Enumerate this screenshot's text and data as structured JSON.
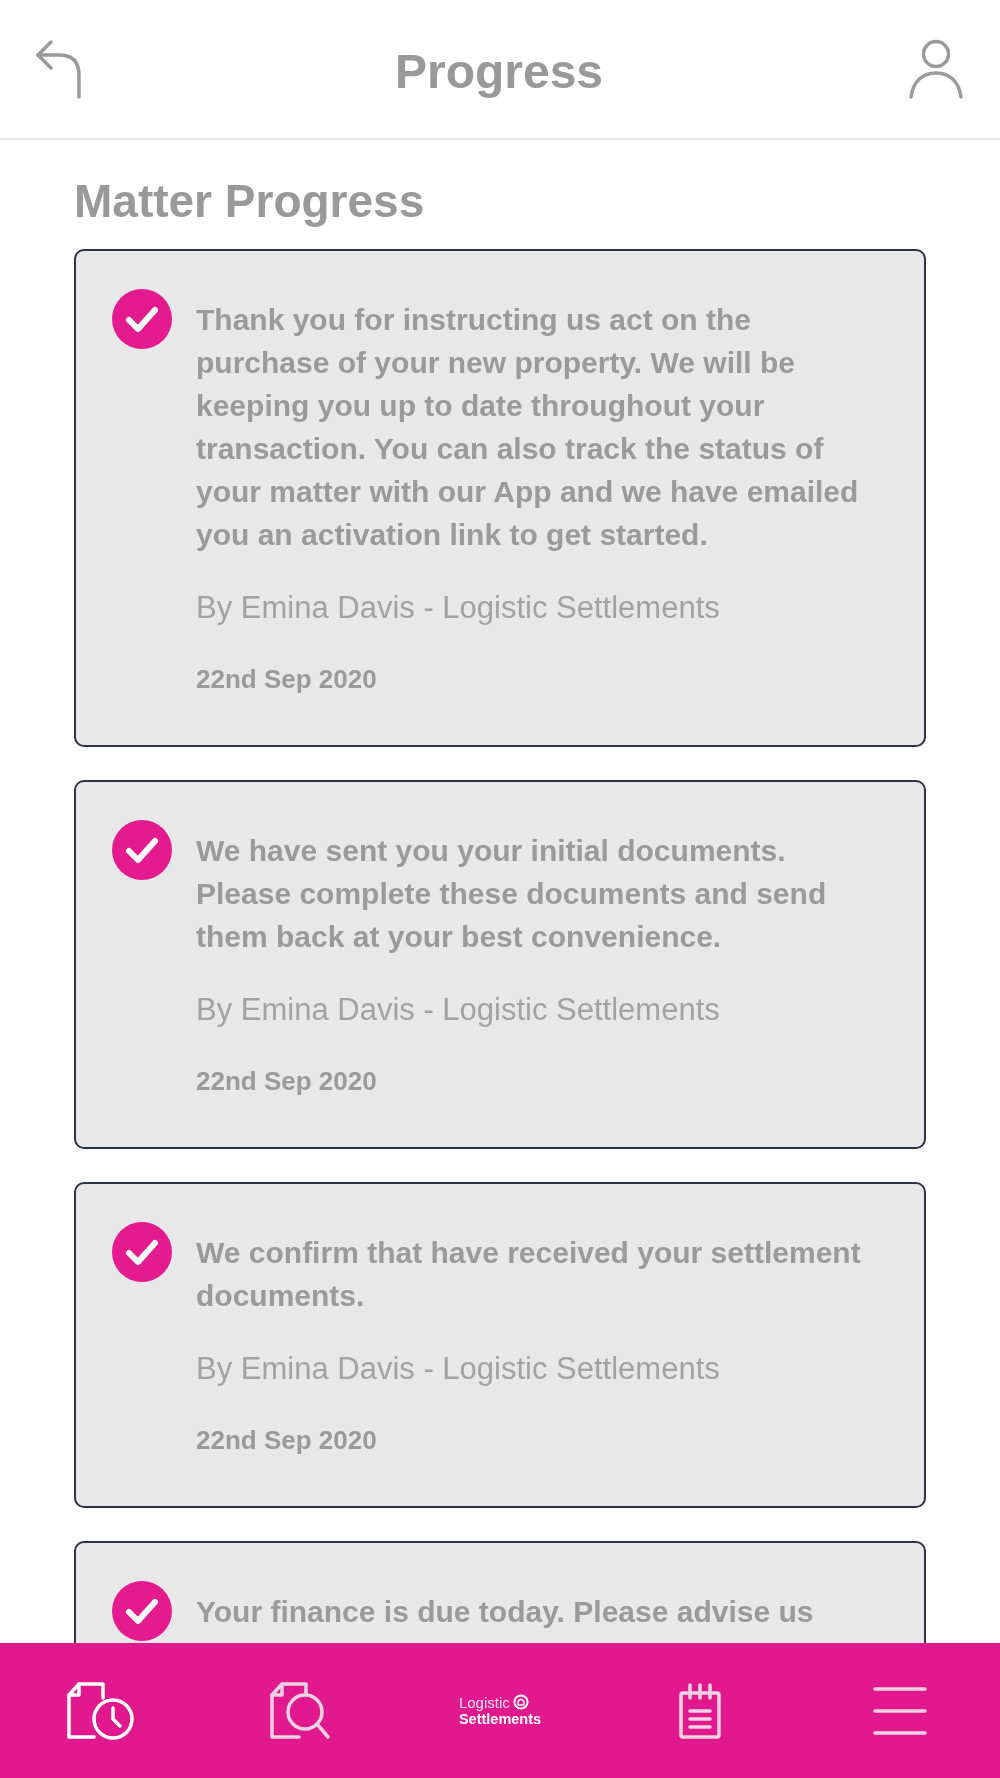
{
  "header": {
    "title": "Progress"
  },
  "section_title": "Matter Progress",
  "cards": [
    {
      "checked": true,
      "message": "Thank you for instructing us act on the purchase of your new property. We will be keeping you up to date throughout your transaction. You can also track the status of your matter with our App and we have emailed you an activation link to get started.",
      "author": "By Emina Davis - Logistic Settlements",
      "date": "22nd Sep 2020"
    },
    {
      "checked": true,
      "message": "We have sent you your initial documents. Please complete these documents and send them back at your best convenience.",
      "author": "By Emina Davis - Logistic Settlements",
      "date": "22nd Sep 2020"
    },
    {
      "checked": true,
      "message": "We confirm that have received your settlement documents.",
      "author": "By Emina Davis - Logistic Settlements",
      "date": "22nd Sep 2020"
    },
    {
      "checked": true,
      "message": "Your finance is due today. Please advise us"
    }
  ],
  "nav": {
    "items": [
      {
        "kind": "icon",
        "selected": true
      },
      {
        "kind": "icon",
        "selected": false
      },
      {
        "kind": "logo",
        "line_1": "Logistic",
        "line_2": "Settlements",
        "selected": false
      },
      {
        "kind": "icon",
        "selected": false
      },
      {
        "kind": "icon",
        "selected": false
      }
    ]
  }
}
